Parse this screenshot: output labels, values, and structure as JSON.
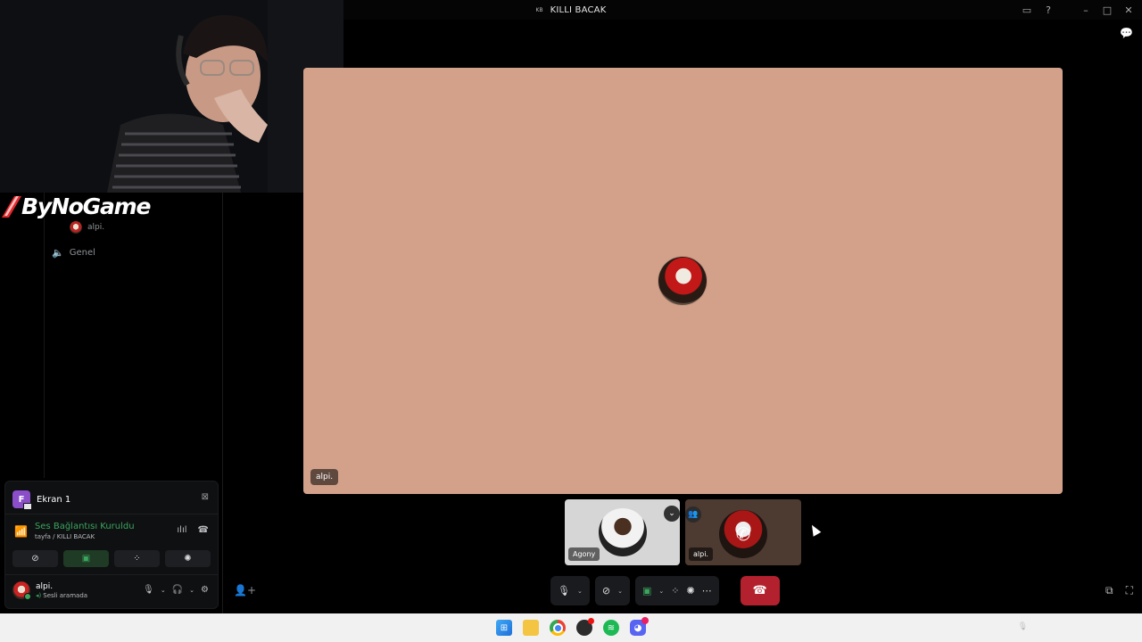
{
  "window": {
    "badge": "KB",
    "title": "KILLI BACAK"
  },
  "brand": {
    "name": "ByNoGame"
  },
  "sidebar": {
    "voice_user": "alpi.",
    "channel": "Genel"
  },
  "screen_share": {
    "label": "Ekran 1",
    "letter": "F"
  },
  "connection": {
    "status": "Ses Bağlantısı Kuruldu",
    "path": "tayfa / KILLI BACAK"
  },
  "me": {
    "name": "alpi.",
    "status": "Sesli aramada"
  },
  "stage": {
    "tag": "alpi."
  },
  "thumbnails": [
    {
      "label": "Agony"
    },
    {
      "label": "alpi."
    }
  ],
  "icons": {
    "accent_green": "#3ba55d",
    "hangup_red": "#b3212e",
    "stage_bg": "#d3a18a"
  }
}
